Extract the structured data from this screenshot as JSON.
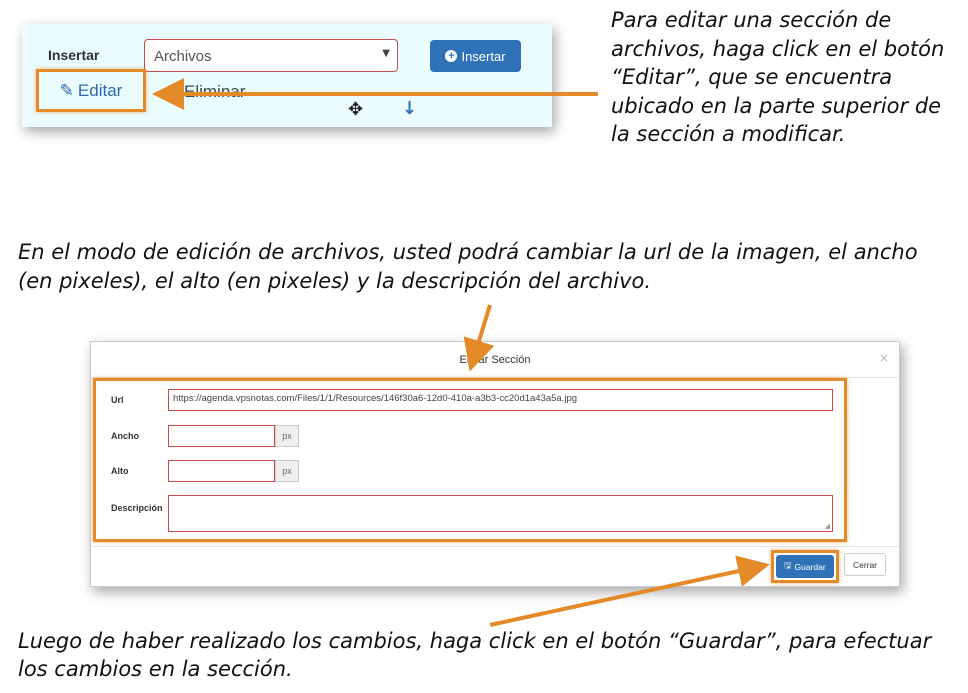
{
  "toolbar": {
    "insert_label": "Insertar",
    "select_value": "Archivos",
    "insert_button_label": "Insertar",
    "edit_label": "Editar",
    "delete_label": "Eliminar",
    "move_icon": "move-icon",
    "down_icon": "arrow-down-icon"
  },
  "instructions": {
    "edit": "Para editar una sección de archivos, haga click en el botón “Editar”, que se encuentra ubicado en la parte superior de la sección a modificar.",
    "edit_mode": "En el modo de edición de archivos, usted podrá cambiar la url de la imagen, el ancho (en pixeles), el alto (en pixeles) y la descripción del archivo.",
    "save": "Luego de haber realizado los cambios, haga click en el botón “Guardar”, para efectuar los cambios en la sección."
  },
  "modal": {
    "title": "Editar Sección",
    "close_symbol": "×",
    "url_label": "Url",
    "url_value": "https://agenda.vpsnotas.com/Files/1/1/Resources/146f30a6-12d0-410a-a3b3-cc20d1a43a5a.jpg",
    "ancho_label": "Ancho",
    "ancho_value": "",
    "alto_label": "Alto",
    "alto_value": "",
    "px_addon": "px",
    "description_label": "Descripción",
    "description_value": "",
    "save_button_label": "Guardar",
    "close_button_label": "Cerrar"
  },
  "colors": {
    "highlight": "#e48a29",
    "primary": "#2f72b8",
    "panel_bg": "#eafcfd",
    "input_border": "#c94a4a"
  }
}
